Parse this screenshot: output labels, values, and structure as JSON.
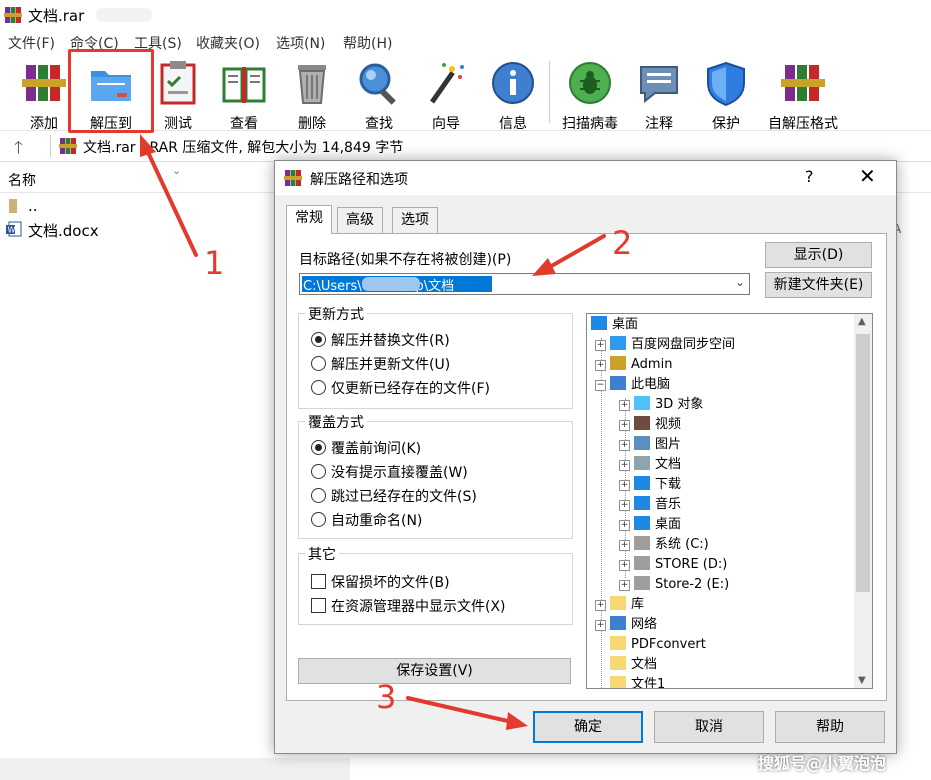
{
  "window": {
    "title": "文档.rar"
  },
  "menu": [
    "文件(F)",
    "命令(C)",
    "工具(S)",
    "收藏夹(O)",
    "选项(N)",
    "帮助(H)"
  ],
  "toolbar": [
    {
      "label": "添加",
      "icon": "books-icon"
    },
    {
      "label": "解压到",
      "icon": "folder-extract-icon"
    },
    {
      "label": "测试",
      "icon": "clipboard-check-icon"
    },
    {
      "label": "查看",
      "icon": "open-book-icon"
    },
    {
      "label": "删除",
      "icon": "trash-icon"
    },
    {
      "label": "查找",
      "icon": "magnifier-icon"
    },
    {
      "label": "向导",
      "icon": "magic-wand-icon"
    },
    {
      "label": "信息",
      "icon": "info-icon"
    },
    {
      "label": "扫描病毒",
      "icon": "bug-scan-icon"
    },
    {
      "label": "注释",
      "icon": "comment-icon"
    },
    {
      "label": "保护",
      "icon": "shield-icon"
    },
    {
      "label": "自解压格式",
      "icon": "sfx-books-icon"
    }
  ],
  "address": {
    "text": "文档.rar - RAR 压缩文件, 解包大小为 14,849 字节"
  },
  "filelist": {
    "column_name": "名称",
    "rows": [
      "..",
      "文档.docx"
    ],
    "right_cut_text": "A"
  },
  "annotations": {
    "n1": "1",
    "n2": "2",
    "n3": "3"
  },
  "dialog": {
    "title": "解压路径和选项",
    "help_glyph": "?",
    "close_glyph": "✕",
    "tabs": [
      "常规",
      "高级",
      "选项"
    ],
    "dest_label": "目标路径(如果不存在将被创建)(P)",
    "dest_value": "C:\\Users\\        \\Desktop\\文档",
    "show_button": "显示(D)",
    "new_folder_button": "新建文件夹(E)",
    "update_group": {
      "title": "更新方式",
      "options": [
        "解压并替换文件(R)",
        "解压并更新文件(U)",
        "仅更新已经存在的文件(F)"
      ],
      "selected": 0
    },
    "overwrite_group": {
      "title": "覆盖方式",
      "options": [
        "覆盖前询问(K)",
        "没有提示直接覆盖(W)",
        "跳过已经存在的文件(S)",
        "自动重命名(N)"
      ],
      "selected": 0
    },
    "misc_group": {
      "title": "其它",
      "checks": [
        "保留损坏的文件(B)",
        "在资源管理器中显示文件(X)"
      ]
    },
    "save_settings_button": "保存设置(V)",
    "tree": [
      {
        "label": "桌面",
        "level": 0,
        "expander": "",
        "icon": "desktop-icon"
      },
      {
        "label": "百度网盘同步空间",
        "level": 1,
        "expander": "+",
        "icon": "baidu-icon"
      },
      {
        "label": "Admin",
        "level": 1,
        "expander": "+",
        "icon": "user-icon"
      },
      {
        "label": "此电脑",
        "level": 1,
        "expander": "−",
        "icon": "computer-icon"
      },
      {
        "label": "3D 对象",
        "level": 2,
        "expander": "+",
        "icon": "3d-icon"
      },
      {
        "label": "视频",
        "level": 2,
        "expander": "+",
        "icon": "video-icon"
      },
      {
        "label": "图片",
        "level": 2,
        "expander": "+",
        "icon": "pictures-icon"
      },
      {
        "label": "文档",
        "level": 2,
        "expander": "+",
        "icon": "documents-icon"
      },
      {
        "label": "下载",
        "level": 2,
        "expander": "+",
        "icon": "download-icon"
      },
      {
        "label": "音乐",
        "level": 2,
        "expander": "+",
        "icon": "music-icon"
      },
      {
        "label": "桌面",
        "level": 2,
        "expander": "+",
        "icon": "desktop-icon"
      },
      {
        "label": "系统 (C:)",
        "level": 2,
        "expander": "+",
        "icon": "drive-icon"
      },
      {
        "label": "STORE (D:)",
        "level": 2,
        "expander": "+",
        "icon": "drive-icon"
      },
      {
        "label": "Store-2 (E:)",
        "level": 2,
        "expander": "+",
        "icon": "drive-icon"
      },
      {
        "label": "库",
        "level": 1,
        "expander": "+",
        "icon": "library-icon"
      },
      {
        "label": "网络",
        "level": 1,
        "expander": "+",
        "icon": "network-icon"
      },
      {
        "label": "PDFconvert",
        "level": 1,
        "expander": "",
        "icon": "folder-icon"
      },
      {
        "label": "文档",
        "level": 1,
        "expander": "",
        "icon": "folder-icon"
      },
      {
        "label": "文件1",
        "level": 1,
        "expander": "",
        "icon": "folder-icon"
      }
    ],
    "ok_button": "确定",
    "cancel_button": "取消",
    "help_button": "帮助"
  },
  "watermark": "搜狐号@小翼泡泡",
  "colors": {
    "annotation_red": "#e23b2e",
    "selection_blue": "#0078d7",
    "folder_yellow": "#f8d775"
  }
}
